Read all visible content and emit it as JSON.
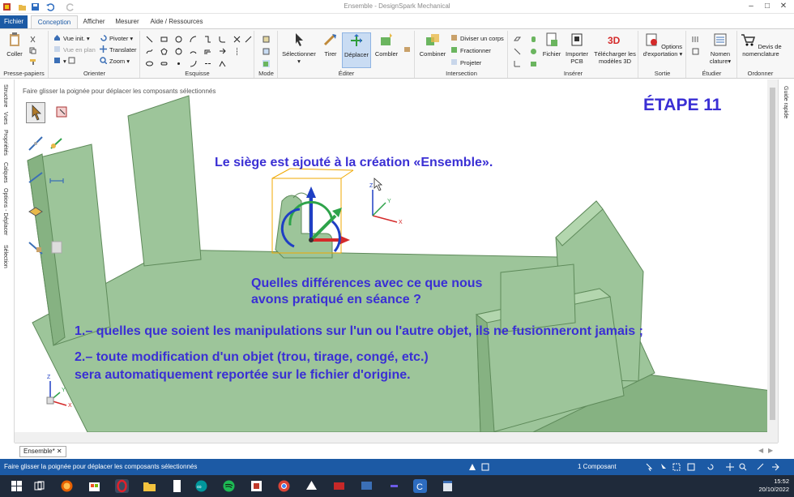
{
  "window": {
    "title": "Ensemble - DesignSpark Mechanical"
  },
  "tabs": {
    "file": "Fichier",
    "items": [
      "Conception",
      "Afficher",
      "Mesurer",
      "Aide / Ressources"
    ],
    "active": "Conception"
  },
  "ribbon": {
    "clipboard": {
      "paste": "Coller",
      "label": "Presse-papiers"
    },
    "orient": {
      "vue_init": "Vue init.",
      "vue_en_plan": "Vue en plan",
      "pivoter": "Pivoter",
      "translater": "Translater",
      "zoom": "Zoom",
      "label": "Orienter"
    },
    "sketch": {
      "label": "Esquisse"
    },
    "mode": {
      "label": "Mode"
    },
    "edit": {
      "selectionner": "Sélectionner",
      "tirer": "Tirer",
      "deplacer": "Déplacer",
      "combler": "Combler",
      "label": "Éditer"
    },
    "intersection": {
      "combiner": "Combiner",
      "diviser": "Diviser un corps",
      "fractionner": "Fractionner",
      "projeter": "Projeter",
      "label": "Intersection"
    },
    "insert": {
      "fichier": "Fichier",
      "importer_pcb_1": "Importer",
      "importer_pcb_2": "PCB",
      "telecharger_1": "Télécharger les",
      "telecharger_2": "modèles 3D",
      "label": "Insérer"
    },
    "output": {
      "options_1": "Options",
      "options_2": "d'exportation",
      "label": "Sortie"
    },
    "study": {
      "nomenclature_1": "Nomen",
      "nomenclature_2": "clature",
      "label": "Étudier"
    },
    "order": {
      "devis_1": "Devis de",
      "devis_2": "nomenclature",
      "label": "Ordonner"
    }
  },
  "left_panel": {
    "tabs": [
      "Structure",
      "Vues",
      "Propriétés",
      "Calques",
      "Options - Déplacer",
      "Sélection"
    ]
  },
  "right_panel": {
    "tabs": [
      "Guide rapide"
    ]
  },
  "viewport": {
    "hint": "Faire glisser la poignée pour déplacer les composants sélectionnés",
    "step": "ÉTAPE 11",
    "line1": "Le siège est ajouté à la création «Ensemble».",
    "question_1": "Quelles différences avec ce que nous",
    "question_2": "avons pratiqué en séance ?",
    "point1": "1.–  quelles que soient les manipulations sur l'un ou l'autre objet, ils ne fusionneront jamais ;",
    "point2_1": "2.–  toute modification d'un objet (trou, tirage, congé, etc.)",
    "point2_2": "sera automatiquement  reportée sur le fichier d'origine.",
    "triad_labels": {
      "z": "Z",
      "y": "Y",
      "x": "X"
    },
    "colors": {
      "part_fill": "#9dc59a",
      "part_top": "#b3d6ae",
      "part_edge": "#5e8a5a",
      "annotation": "#3a2fd4"
    }
  },
  "document_tabs": {
    "items": [
      "Ensemble*"
    ]
  },
  "status_bar": {
    "message": "Faire glisser la poignée pour déplacer les composants sélectionnés",
    "selection_count": "1 Composant"
  },
  "taskbar": {
    "time": "15:52",
    "date": "20/10/2022"
  }
}
